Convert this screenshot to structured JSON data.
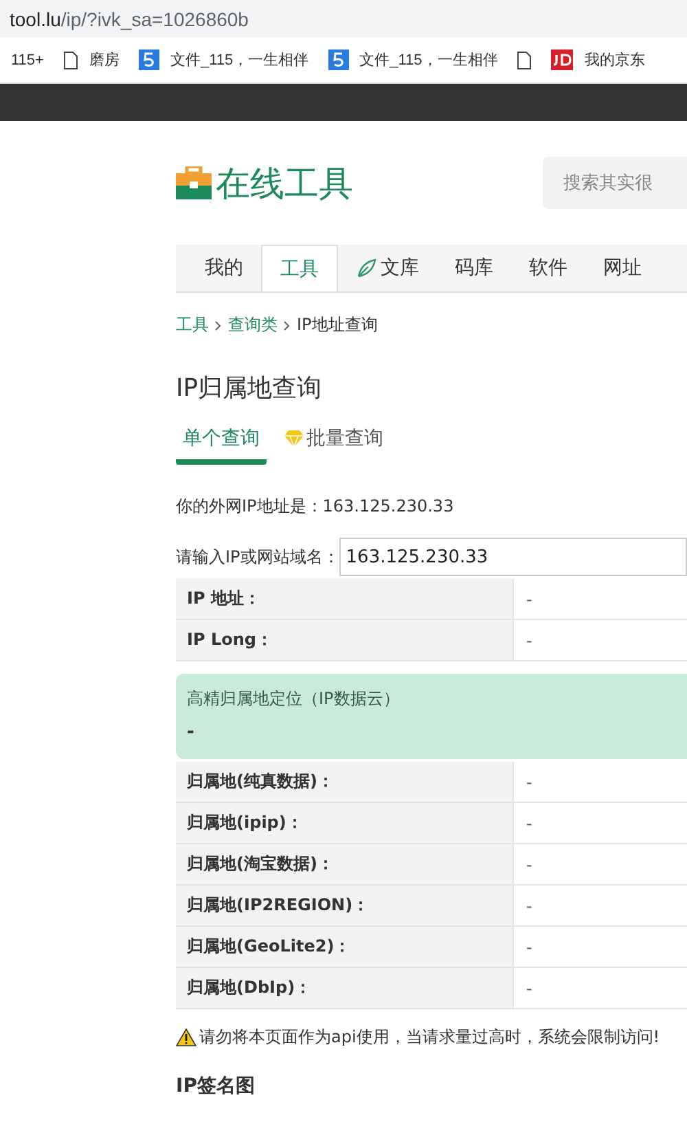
{
  "address_bar": {
    "url_host": "tool.lu",
    "url_path": "/ip/?ivk_sa=1026860b"
  },
  "bookmarks": [
    {
      "kind": "text",
      "label": "115+"
    },
    {
      "kind": "page",
      "label": "磨房"
    },
    {
      "kind": "five",
      "label": "文件_115，一生相伴"
    },
    {
      "kind": "five",
      "label": "文件_115，一生相伴"
    },
    {
      "kind": "page"
    },
    {
      "kind": "jd",
      "label": "我的京东"
    }
  ],
  "logo": {
    "text": "在线工具"
  },
  "search": {
    "placeholder": "搜索其实很"
  },
  "nav": [
    {
      "label": "我的",
      "selected": false,
      "kind": "text"
    },
    {
      "label": "工具",
      "selected": true,
      "kind": "text"
    },
    {
      "label": "文库",
      "selected": false,
      "kind": "leaf"
    },
    {
      "label": "码库",
      "selected": false,
      "kind": "text"
    },
    {
      "label": "软件",
      "selected": false,
      "kind": "text"
    },
    {
      "label": "网址",
      "selected": false,
      "kind": "text"
    }
  ],
  "breadcrumb": [
    {
      "label": "工具",
      "link": true
    },
    {
      "label": "查询类",
      "link": true
    },
    {
      "label": "IP地址查询",
      "link": false
    }
  ],
  "title": "IP归属地查询",
  "subtabs": [
    {
      "label": "单个查询",
      "selected": true,
      "kind": "text"
    },
    {
      "label": "批量查询",
      "selected": false,
      "kind": "gem"
    }
  ],
  "your_ip": {
    "label": "你的外网IP地址是：",
    "value": "163.125.230.33"
  },
  "query": {
    "label": "请输入IP或网站域名：",
    "value": "163.125.230.33"
  },
  "table_1": [
    {
      "label": "IP 地址：",
      "value": "-"
    },
    {
      "label": "IP Long：",
      "value": "-"
    }
  ],
  "precise": {
    "title": "高精归属地定位（IP数据云）",
    "value": "-"
  },
  "table_2": [
    {
      "label": "归属地(纯真数据)：",
      "value": "-"
    },
    {
      "label": "归属地(ipip)：",
      "value": "-"
    },
    {
      "label": "归属地(淘宝数据)：",
      "value": "-"
    },
    {
      "label": "归属地(IP2REGION)：",
      "value": "-"
    },
    {
      "label": "归属地(GeoLite2)：",
      "value": "-"
    },
    {
      "label": "归属地(DbIp)：",
      "value": "-"
    }
  ],
  "warning": "请勿将本页面作为api使用，当请求量过高时，系统会限制访问!",
  "section_title": "IP签名图"
}
